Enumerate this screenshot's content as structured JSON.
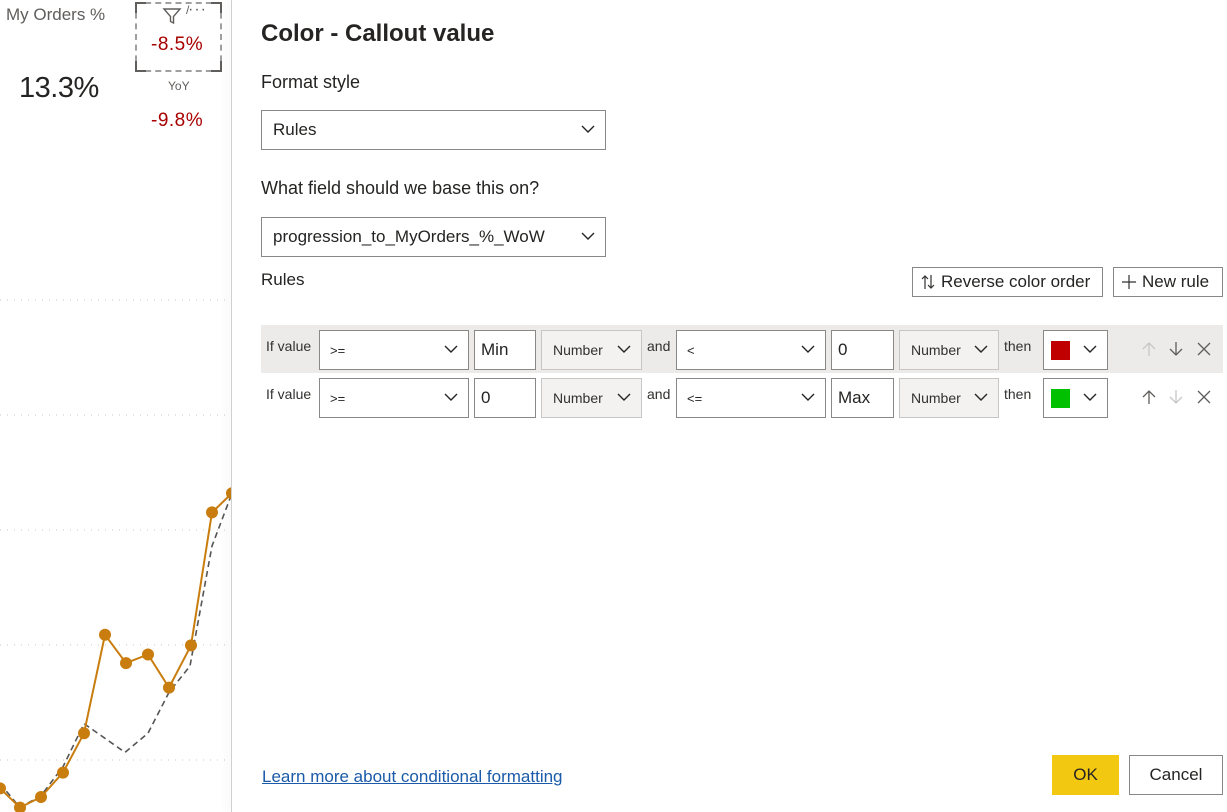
{
  "report": {
    "title": "My Orders %",
    "kpi_value": "13.3%",
    "yoy_label": "YoY",
    "value_top": "-8.5%",
    "value_bottom": "-9.8%",
    "accent_red": "#a80000",
    "line_color": "#c87d0e"
  },
  "chart_data": {
    "type": "line",
    "series": [
      {
        "values": [
          0.45,
          0.05,
          0.27,
          0.78,
          1.6,
          3.65,
          3.06,
          3.24,
          2.55,
          3.43,
          6.2,
          6.6
        ]
      },
      {
        "values": [
          0.55,
          0.05,
          0.3,
          0.9,
          1.8,
          1.2,
          1.6,
          2.45,
          3.0,
          5.5,
          6.6
        ]
      }
    ]
  },
  "dialog": {
    "title": "Color - Callout value",
    "format_style_label": "Format style",
    "format_style_value": "Rules",
    "field_label": "What field should we base this on?",
    "field_value": "progression_to_MyOrders_%_WoW",
    "rules_label": "Rules",
    "reverse_button": "Reverse color order",
    "new_rule_button": "New rule",
    "rules": [
      {
        "if_label": "If value",
        "op1": ">=",
        "val1": "Min",
        "type1": "Number",
        "and_label": "and",
        "op2": "<",
        "val2": "0",
        "type2": "Number",
        "then_label": "then",
        "color": "#c00000"
      },
      {
        "if_label": "If value",
        "op1": ">=",
        "val1": "0",
        "type1": "Number",
        "and_label": "and",
        "op2": "<=",
        "val2": "Max",
        "type2": "Number",
        "then_label": "then",
        "color": "#00c000"
      }
    ],
    "learn_more_link": "Learn more about conditional formatting",
    "ok_button": "OK",
    "cancel_button": "Cancel"
  }
}
